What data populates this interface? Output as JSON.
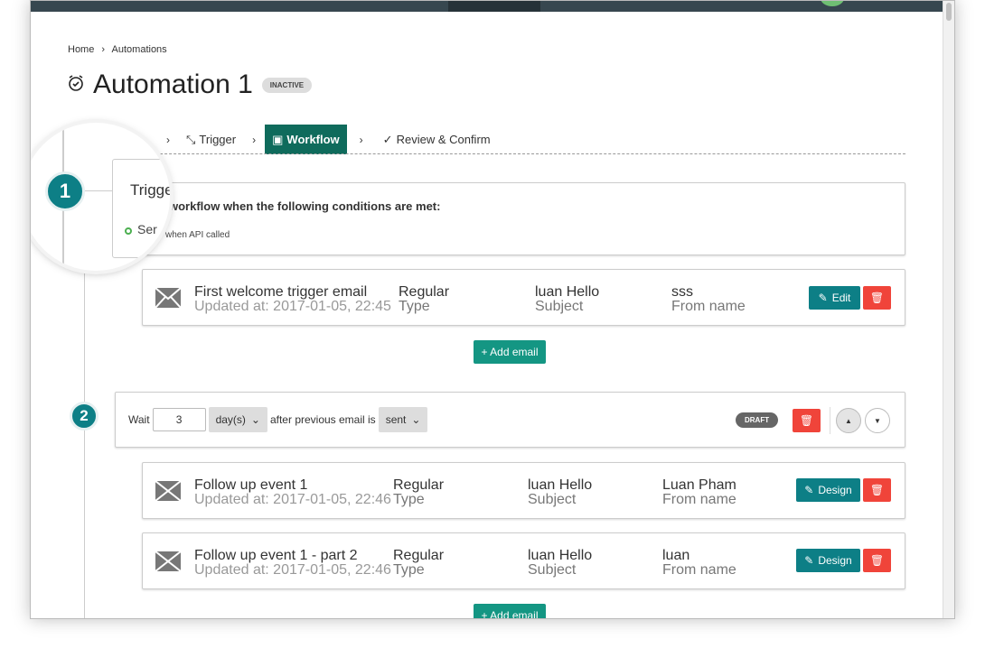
{
  "breadcrumb": {
    "home": "Home",
    "sep": "›",
    "current": "Automations"
  },
  "page": {
    "title": "Automation 1",
    "status": "INACTIVE"
  },
  "steps": [
    {
      "label": "Trigger"
    },
    {
      "label": "Workflow"
    },
    {
      "label": "Review & Confirm"
    }
  ],
  "step_sep": "›",
  "trigger": {
    "number": "1",
    "title": "Trigger",
    "title_partial": "Trigge",
    "desc": "workflow when the following conditions are met:",
    "item_partial": "Ser",
    "item": "when API called"
  },
  "emails_1": [
    {
      "name": "First welcome trigger email",
      "updated": "Updated at: 2017-01-05, 22:45",
      "type": "Regular",
      "type_label": "Type",
      "subject": "luan Hello",
      "subject_label": "Subject",
      "from": "sss",
      "from_label": "From name",
      "action": "Edit"
    }
  ],
  "add_email": "+ Add email",
  "wait": {
    "number": "2",
    "label": "Wait",
    "value": "3",
    "unit": "day(s)",
    "after": "after previous email is",
    "event": "sent",
    "status": "DRAFT"
  },
  "emails_2": [
    {
      "name": "Follow up event 1",
      "updated": "Updated at: 2017-01-05, 22:46",
      "type": "Regular",
      "type_label": "Type",
      "subject": "luan Hello",
      "subject_label": "Subject",
      "from": "Luan Pham",
      "from_label": "From name",
      "action": "Design"
    },
    {
      "name": "Follow up event 1 - part 2",
      "updated": "Updated at: 2017-01-05, 22:46",
      "type": "Regular",
      "type_label": "Type",
      "subject": "luan Hello",
      "subject_label": "Subject",
      "from": "luan",
      "from_label": "From name",
      "action": "Design"
    }
  ],
  "colors": {
    "primary": "#0d7f86",
    "active_step": "#0f6b5c",
    "danger": "#f0443a",
    "add": "#149683"
  }
}
